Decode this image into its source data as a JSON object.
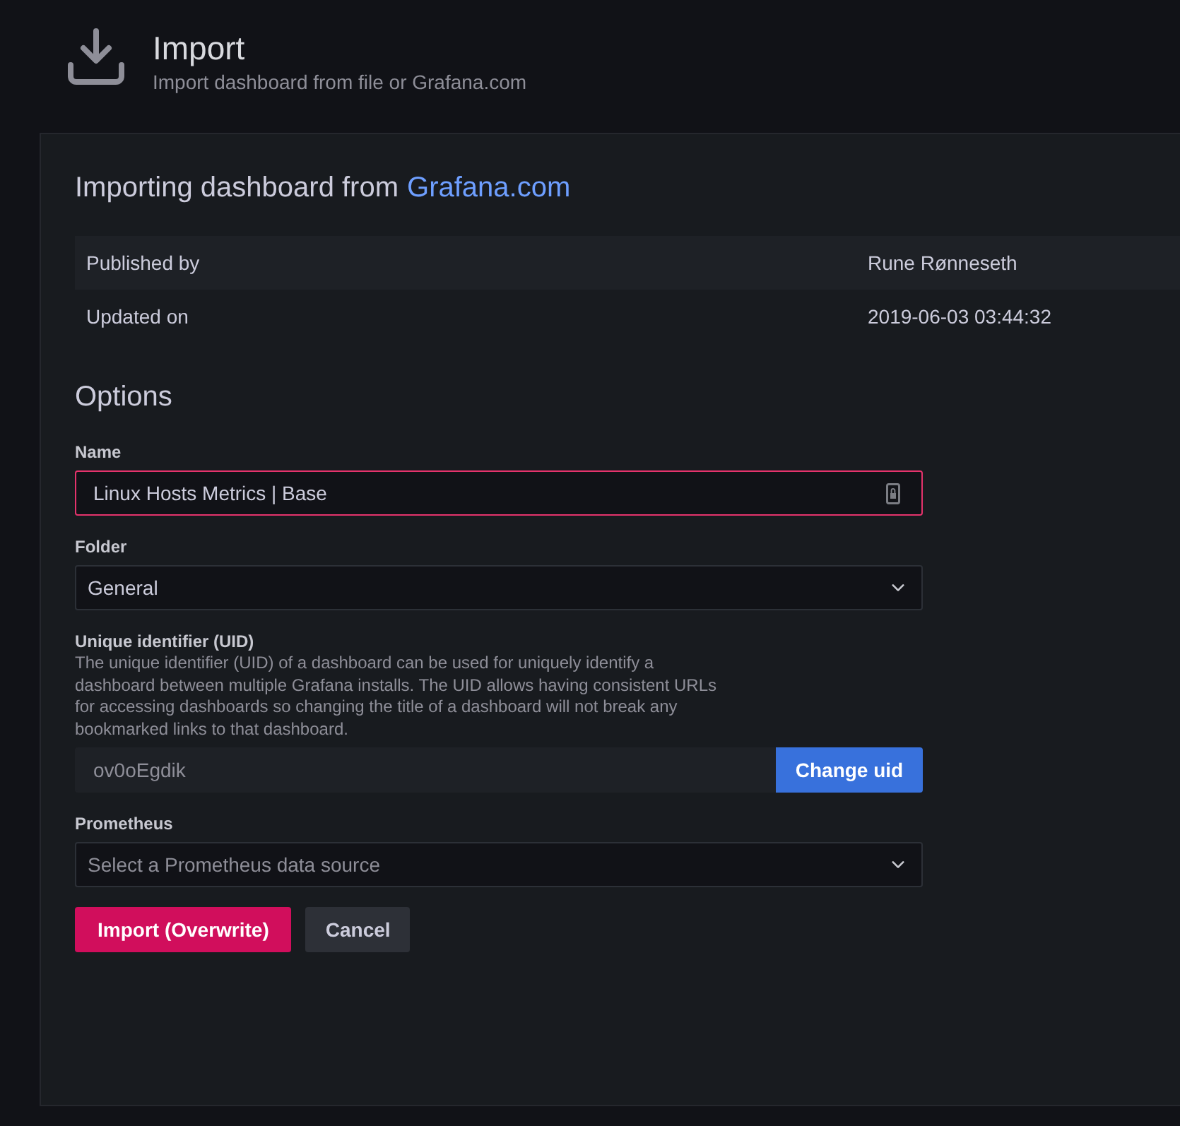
{
  "header": {
    "title": "Import",
    "subtitle": "Import dashboard from file or Grafana.com"
  },
  "source": {
    "heading": "Importing dashboard from",
    "link": "Grafana.com"
  },
  "info_table": {
    "rows": [
      {
        "label": "Published by",
        "value": "Rune Rønneseth"
      },
      {
        "label": "Updated on",
        "value": "2019-06-03 03:44:32"
      }
    ]
  },
  "options": {
    "heading": "Options",
    "fields": [
      {
        "kind": "text",
        "label": "Name",
        "value": "Linux Hosts Metrics | Base",
        "invalid": true
      },
      {
        "kind": "select",
        "label": "Folder",
        "value": "General"
      },
      {
        "kind": "uid",
        "label": "Unique identifier (UID)",
        "description": "The unique identifier (UID) of a dashboard can be used for uniquely identify a\ndashboard between multiple Grafana installs. The UID allows having consistent URLs\nfor accessing dashboards so changing the title of a dashboard will not break any\nbookmarked links to that dashboard.",
        "value": "ov0oEgdik",
        "disabled": true,
        "button": "Change uid"
      },
      {
        "kind": "select",
        "label": "Prometheus",
        "placeholder": "Select a Prometheus data source"
      }
    ]
  },
  "actions": [
    {
      "kind": "danger",
      "label": "Import (Overwrite)"
    },
    {
      "kind": "secondary",
      "label": "Cancel"
    }
  ]
}
